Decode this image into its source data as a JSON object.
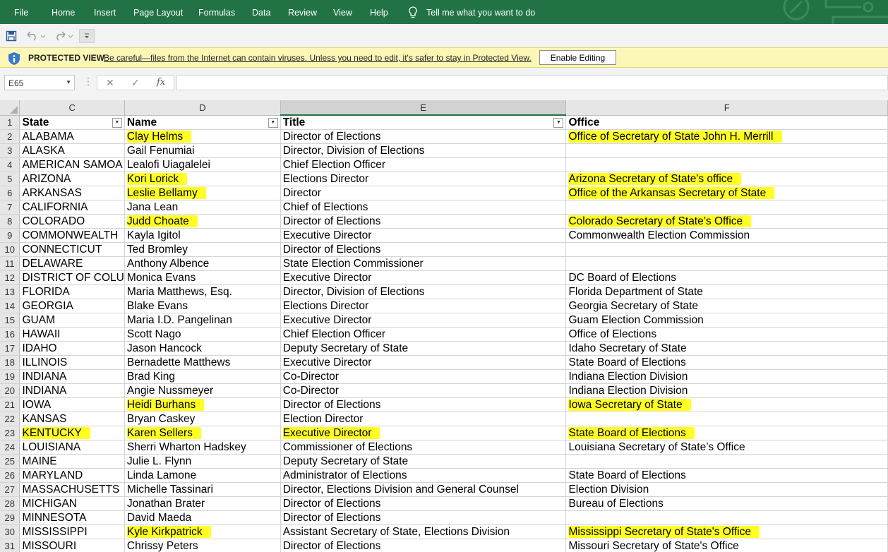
{
  "ribbon": {
    "tabs": [
      "File",
      "Home",
      "Insert",
      "Page Layout",
      "Formulas",
      "Data",
      "Review",
      "View",
      "Help"
    ],
    "tell_me": "Tell me what you want to do",
    "color": "#217346"
  },
  "protected_view": {
    "title": "PROTECTED VIEW",
    "message": "Be careful—files from the Internet can contain viruses. Unless you need to edit, it's safer to stay in Protected View.",
    "button": "Enable Editing"
  },
  "formula_bar": {
    "name_box": "E65",
    "fx": "fx",
    "formula": ""
  },
  "columns": [
    "C",
    "D",
    "E",
    "F"
  ],
  "header_row": {
    "row": "1",
    "cells": [
      "State",
      "Name",
      "Title",
      "Office"
    ]
  },
  "highlight_color": "#ffff22",
  "rows": [
    {
      "row": "2",
      "cells": [
        "ALABAMA",
        "Clay Helms",
        "Director of Elections",
        "Office of Secretary of State John H. Merrill"
      ],
      "hl": [
        false,
        true,
        false,
        true
      ]
    },
    {
      "row": "3",
      "cells": [
        "ALASKA",
        "Gail Fenumiai",
        "Director, Division of Elections",
        ""
      ],
      "hl": [
        false,
        false,
        false,
        false
      ]
    },
    {
      "row": "4",
      "cells": [
        "AMERICAN SAMOA",
        "Lealofi Uiagalelei",
        "Chief Election Officer",
        ""
      ],
      "hl": [
        false,
        false,
        false,
        false
      ]
    },
    {
      "row": "5",
      "cells": [
        "ARIZONA",
        "Kori Lorick",
        "Elections Director",
        "Arizona Secretary of State's office"
      ],
      "hl": [
        false,
        true,
        false,
        true
      ]
    },
    {
      "row": "6",
      "cells": [
        "ARKANSAS",
        "Leslie Bellamy",
        "Director",
        "Office of the Arkansas Secretary of State"
      ],
      "hl": [
        false,
        true,
        false,
        true
      ]
    },
    {
      "row": "7",
      "cells": [
        "CALIFORNIA",
        "Jana Lean",
        "Chief of Elections",
        ""
      ],
      "hl": [
        false,
        false,
        false,
        false
      ]
    },
    {
      "row": "8",
      "cells": [
        "COLORADO",
        "Judd Choate",
        "Director of Elections",
        "Colorado Secretary of State’s Office"
      ],
      "hl": [
        false,
        true,
        false,
        true
      ]
    },
    {
      "row": "9",
      "cells": [
        "COMMONWEALTH",
        "Kayla Igitol",
        "Executive Director",
        "Commonwealth Election Commission"
      ],
      "hl": [
        false,
        false,
        false,
        false
      ]
    },
    {
      "row": "10",
      "cells": [
        "CONNECTICUT",
        "Ted Bromley",
        "Director of Elections",
        ""
      ],
      "hl": [
        false,
        false,
        false,
        false
      ]
    },
    {
      "row": "11",
      "cells": [
        "DELAWARE",
        "Anthony Albence",
        "State Election Commissioner",
        ""
      ],
      "hl": [
        false,
        false,
        false,
        false
      ]
    },
    {
      "row": "12",
      "cells": [
        "DISTRICT OF COLU",
        "Monica Evans",
        "Executive Director",
        "DC Board of Elections"
      ],
      "hl": [
        false,
        false,
        false,
        false
      ]
    },
    {
      "row": "13",
      "cells": [
        "FLORIDA",
        "Maria Matthews, Esq.",
        "Director, Division of Elections",
        "Florida Department of State"
      ],
      "hl": [
        false,
        false,
        false,
        false
      ]
    },
    {
      "row": "14",
      "cells": [
        "GEORGIA",
        "Blake Evans",
        "Elections Director",
        "Georgia Secretary of State"
      ],
      "hl": [
        false,
        false,
        false,
        false
      ]
    },
    {
      "row": "15",
      "cells": [
        "GUAM",
        "Maria I.D. Pangelinan",
        "Executive Director",
        "Guam Election Commission"
      ],
      "hl": [
        false,
        false,
        false,
        false
      ]
    },
    {
      "row": "16",
      "cells": [
        "HAWAII",
        "Scott Nago",
        "Chief Election Officer",
        "Office of Elections"
      ],
      "hl": [
        false,
        false,
        false,
        false
      ]
    },
    {
      "row": "17",
      "cells": [
        "IDAHO",
        "Jason Hancock",
        "Deputy Secretary of State",
        "Idaho Secretary of State"
      ],
      "hl": [
        false,
        false,
        false,
        false
      ]
    },
    {
      "row": "18",
      "cells": [
        "ILLINOIS",
        "Bernadette Matthews",
        "Executive Director",
        "State Board of Elections"
      ],
      "hl": [
        false,
        false,
        false,
        false
      ]
    },
    {
      "row": "19",
      "cells": [
        "INDIANA",
        "Brad King",
        "Co-Director",
        "Indiana Election Division"
      ],
      "hl": [
        false,
        false,
        false,
        false
      ]
    },
    {
      "row": "20",
      "cells": [
        "INDIANA",
        "Angie Nussmeyer",
        "Co-Director",
        "Indiana Election Division"
      ],
      "hl": [
        false,
        false,
        false,
        false
      ]
    },
    {
      "row": "21",
      "cells": [
        "IOWA",
        "Heidi Burhans",
        "Director of Elections",
        "Iowa Secretary of State"
      ],
      "hl": [
        false,
        true,
        false,
        true
      ]
    },
    {
      "row": "22",
      "cells": [
        "KANSAS",
        "Bryan Caskey",
        "Election Director",
        ""
      ],
      "hl": [
        false,
        false,
        false,
        false
      ]
    },
    {
      "row": "23",
      "cells": [
        "KENTUCKY",
        "Karen Sellers",
        "Executive Director",
        "State Board of Elections"
      ],
      "hl": [
        true,
        true,
        true,
        true
      ]
    },
    {
      "row": "24",
      "cells": [
        "LOUISIANA",
        "Sherri Wharton Hadskey",
        "Commissioner of Elections",
        "Louisiana Secretary of State’s Office"
      ],
      "hl": [
        false,
        false,
        false,
        false
      ]
    },
    {
      "row": "25",
      "cells": [
        "MAINE",
        "Julie L. Flynn",
        "Deputy Secretary of State",
        ""
      ],
      "hl": [
        false,
        false,
        false,
        false
      ]
    },
    {
      "row": "26",
      "cells": [
        "MARYLAND",
        "Linda Lamone",
        "Administrator of Elections",
        "State Board of Elections"
      ],
      "hl": [
        false,
        false,
        false,
        false
      ]
    },
    {
      "row": "27",
      "cells": [
        "MASSACHUSETTS",
        "Michelle Tassinari",
        "Director, Elections Division and General Counsel",
        "Election Division"
      ],
      "hl": [
        false,
        false,
        false,
        false
      ]
    },
    {
      "row": "28",
      "cells": [
        "MICHIGAN",
        "Jonathan Brater",
        "Director of Elections",
        "Bureau of Elections"
      ],
      "hl": [
        false,
        false,
        false,
        false
      ]
    },
    {
      "row": "29",
      "cells": [
        "MINNESOTA",
        "David Maeda",
        "Director of Elections",
        ""
      ],
      "hl": [
        false,
        false,
        false,
        false
      ]
    },
    {
      "row": "30",
      "cells": [
        "MISSISSIPPI",
        "Kyle Kirkpatrick",
        "Assistant Secretary of State, Elections Division",
        "Mississippi Secretary of State's Office"
      ],
      "hl": [
        false,
        true,
        false,
        true
      ]
    },
    {
      "row": "31",
      "cells": [
        "MISSOURI",
        "Chrissy Peters",
        "Director of Elections",
        "Missouri Secretary of State's Office"
      ],
      "hl": [
        false,
        false,
        false,
        false
      ]
    }
  ]
}
